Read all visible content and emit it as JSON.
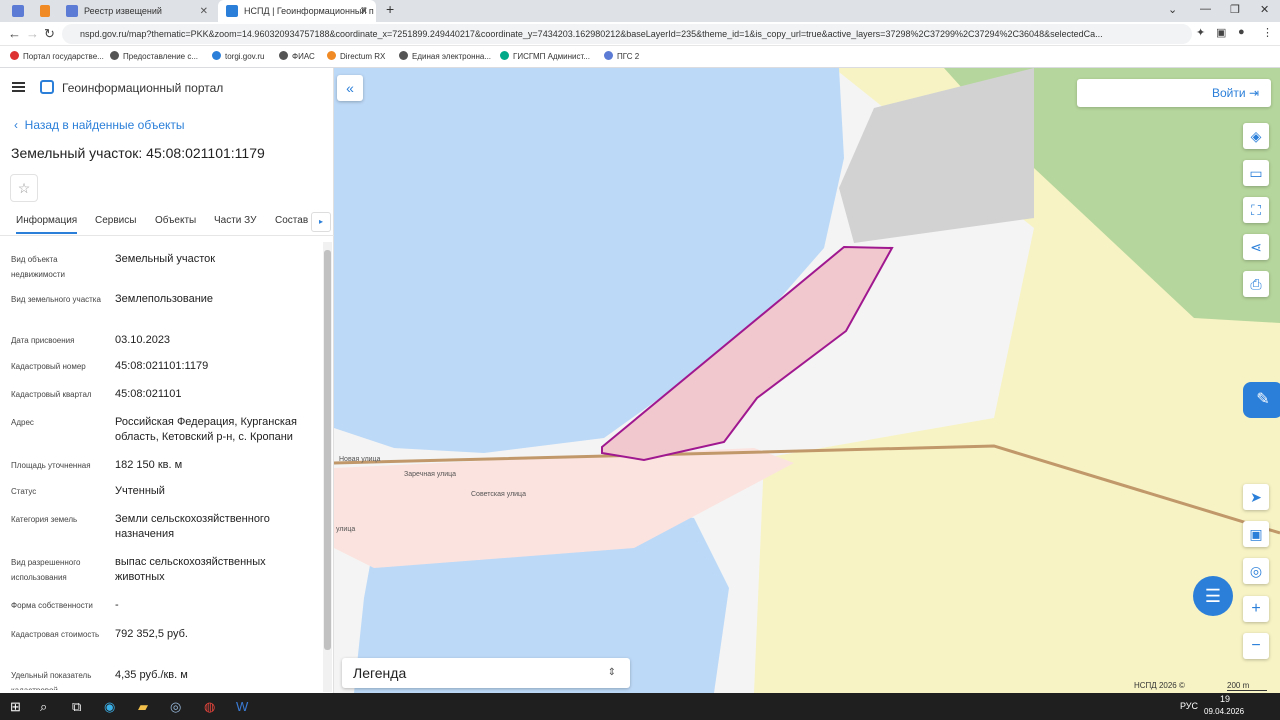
{
  "browser": {
    "tabs": [
      {
        "label": ""
      },
      {
        "label": ""
      },
      {
        "label": "Реестр извещений"
      },
      {
        "label": "НСПД | Геоинформационный п"
      }
    ],
    "url": "nspd.gov.ru/map?thematic=PKK&zoom=14.960320934757188&coordinate_x=7251899.249440217&coordinate_y=7434203.162980212&baseLayerId=235&theme_id=1&is_copy_url=true&active_layers=37298%2C37299%2C37294%2C36048&selectedCa...",
    "bookmarks": [
      "Портал государстве...",
      "Предоставление с...",
      "torgi.gov.ru",
      "ФИАС",
      "Directum RX",
      "Единая электронна...",
      "ГИСГМП Админист...",
      "ПГС 2"
    ]
  },
  "portal": {
    "brand": "Геоинформационный портал",
    "back_label": "Назад в найденные объекты",
    "title": "Земельный участок: 45:08:021101:1179",
    "tabs": [
      "Информация",
      "Сервисы",
      "Объекты",
      "Части ЗУ",
      "Состав"
    ],
    "attributes": [
      {
        "label": "Вид объекта недвижимости",
        "value": "Земельный участок"
      },
      {
        "label": "Вид земельного участка",
        "value": "Землепользование"
      },
      {
        "label": "Дата присвоения",
        "value": "03.10.2023"
      },
      {
        "label": "Кадастровый номер",
        "value": "45:08:021101:1179"
      },
      {
        "label": "Кадастровый квартал",
        "value": "45:08:021101"
      },
      {
        "label": "Адрес",
        "value": "Российская Федерация, Курганская область, Кетовский р-н, с. Кропани"
      },
      {
        "label": "Площадь уточненная",
        "value": "182 150 кв. м"
      },
      {
        "label": "Статус",
        "value": "Учтенный"
      },
      {
        "label": "Категория земель",
        "value": "Земли сельскохозяйственного назначения"
      },
      {
        "label": "Вид разрешенного использования",
        "value": "выпас сельскохозяйственных животных"
      },
      {
        "label": "Форма собственности",
        "value": "-"
      },
      {
        "label": "Кадастровая стоимость",
        "value": "792 352,5 руб."
      },
      {
        "label": "Удельный показатель кадастровой",
        "value": "4,35 руб./кв. м"
      }
    ]
  },
  "map": {
    "login_label": "Войти",
    "legend_label": "Легенда",
    "attribution": "НСПД 2026 ©",
    "scale": "200 m",
    "street_labels": [
      "Новая улица",
      "Заречная улица",
      "Советская улица",
      "улица"
    ]
  },
  "taskbar": {
    "lang": "РУС",
    "time": "19",
    "date": "09.04.2026"
  },
  "colors": {
    "accent": "#2b7fd9",
    "water": "#bcd9f7",
    "field": "#f7f3c4",
    "forest": "#b5d69c",
    "parcel": "#a0188f"
  }
}
